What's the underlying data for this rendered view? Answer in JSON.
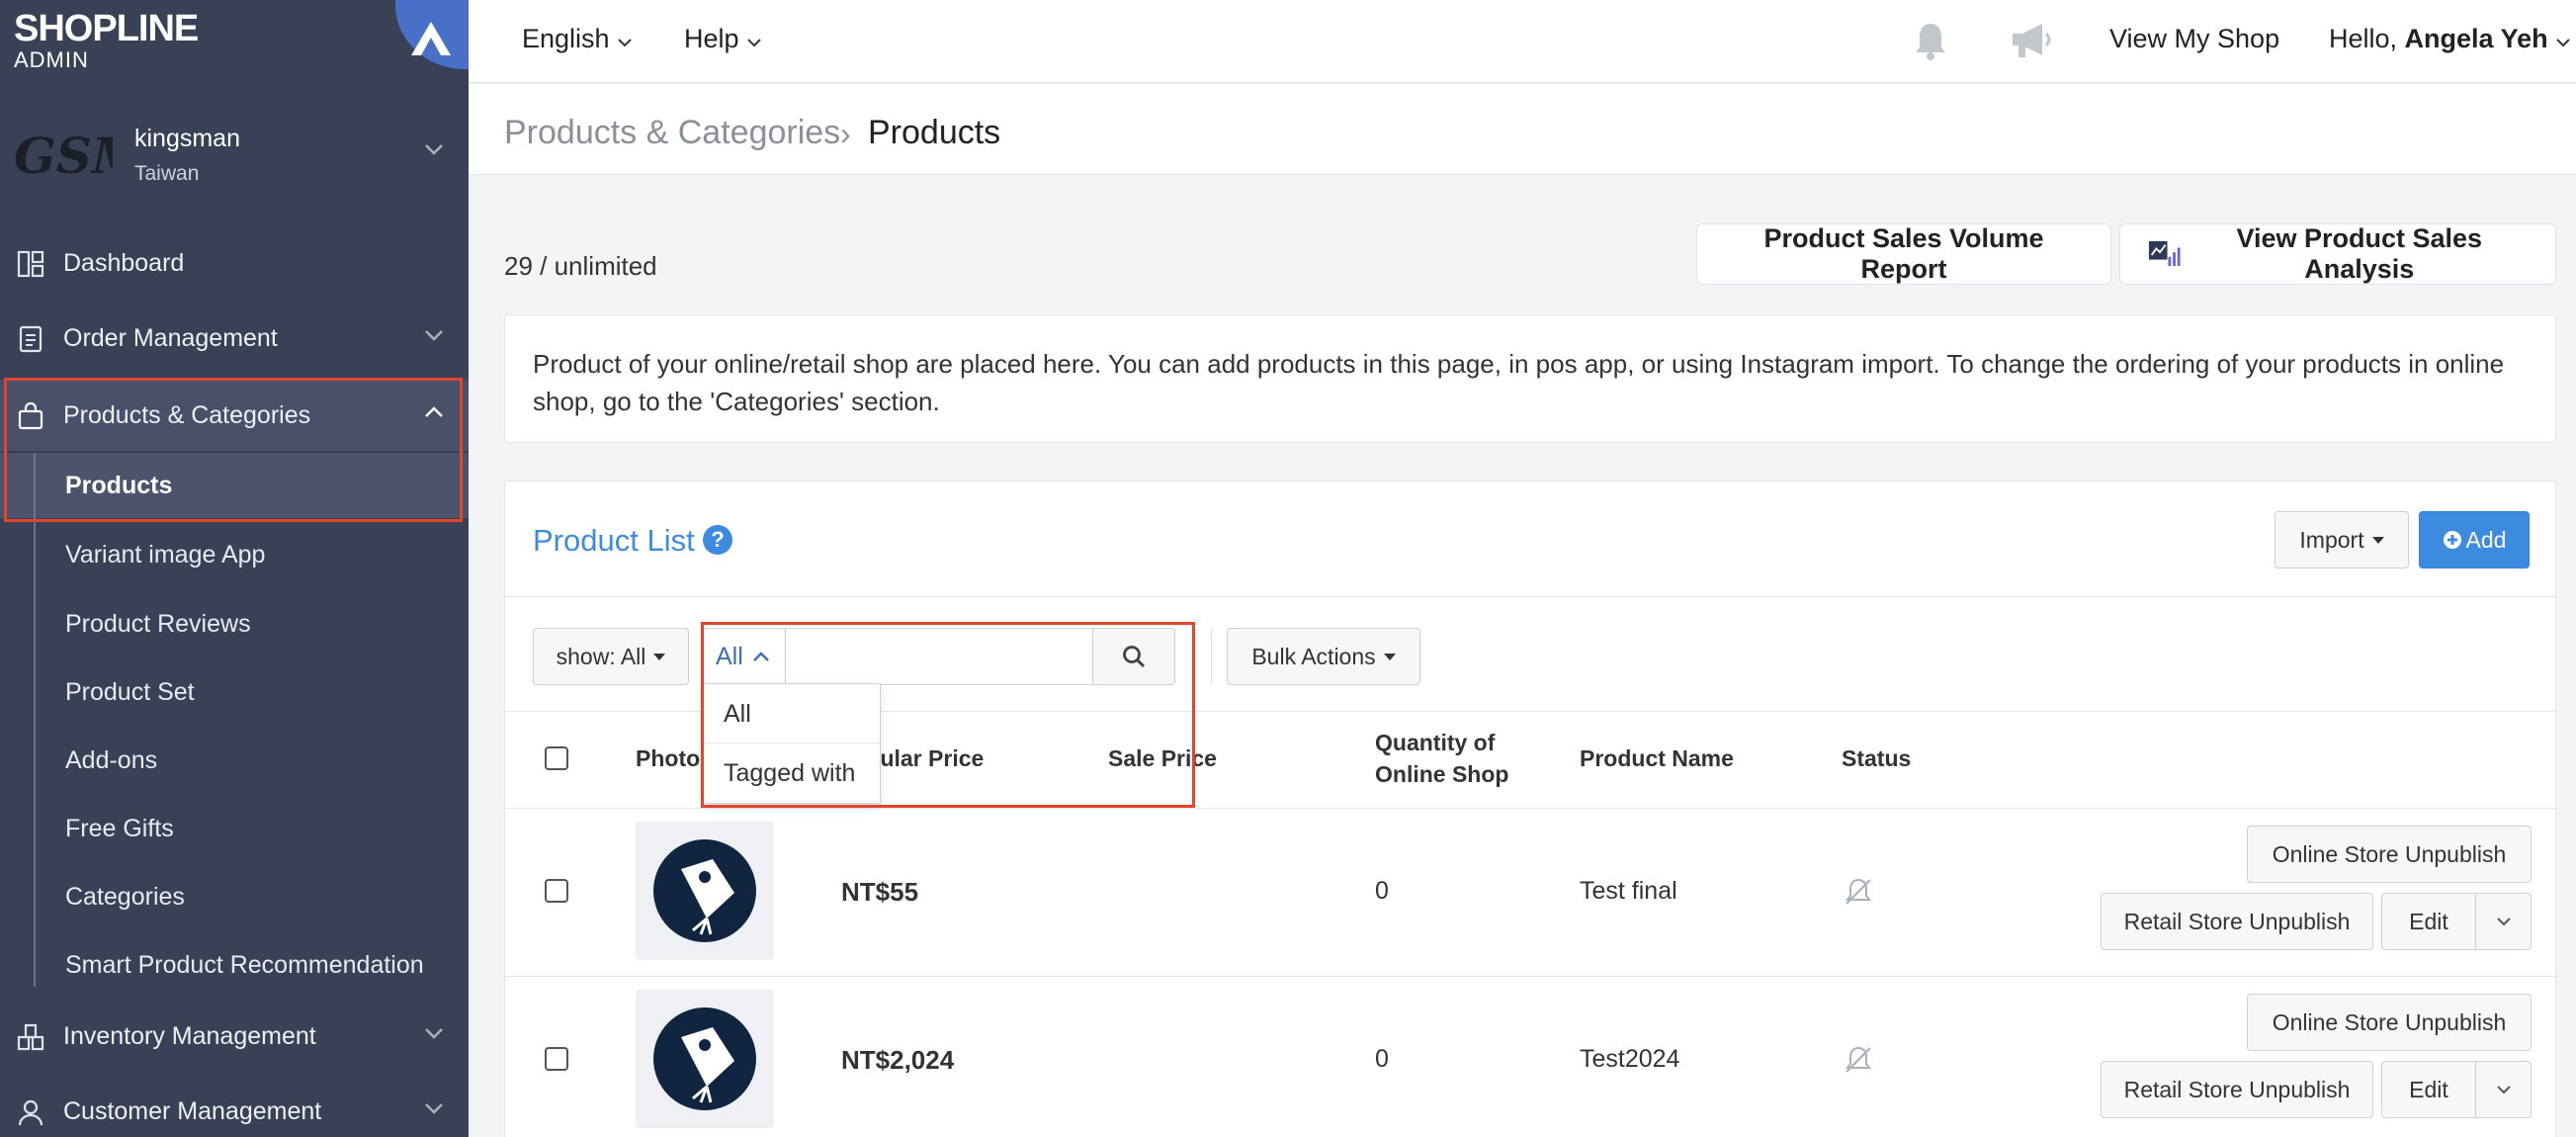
{
  "brand": {
    "logo": "SHOPLINE",
    "subtitle": "ADMIN"
  },
  "shop": {
    "logo_text": "GSM",
    "name": "kingsman",
    "region": "Taiwan"
  },
  "nav": {
    "dashboard": "Dashboard",
    "orders": "Order Management",
    "products": "Products & Categories",
    "inventory": "Inventory Management",
    "customers": "Customer Management"
  },
  "subnav": {
    "products": "Products",
    "variant_image": "Variant image App",
    "reviews": "Product Reviews",
    "product_set": "Product Set",
    "addons": "Add-ons",
    "free_gifts": "Free Gifts",
    "categories": "Categories",
    "recommendation": "Smart Product Recommendation"
  },
  "topbar": {
    "language": "English",
    "help": "Help",
    "view_shop": "View My Shop",
    "greeting": "Hello, ",
    "user": "Angela Yeh"
  },
  "breadcrumb": {
    "parent": "Products & Categories",
    "separator": "›",
    "current": "Products"
  },
  "count": "29 / unlimited",
  "buttons": {
    "sales_volume": "Product Sales Volume Report",
    "sales_analysis": "View Product Sales Analysis",
    "import": "Import",
    "add": "Add",
    "show": "show: All",
    "bulk": "Bulk Actions"
  },
  "info": "Product of your online/retail shop are placed here. You can add products in this page, in pos app, or using Instagram import. To change the ordering of your products in online shop, go to the 'Categories' section.",
  "list": {
    "title": "Product List",
    "help_glyph": "?",
    "search_scope": "All",
    "search_value": "",
    "dropdown": [
      "All",
      "Tagged with"
    ],
    "headers": {
      "photo": "Photo",
      "regular_price": "Regular Price",
      "sale_price": "Sale Price",
      "quantity_line1": "Quantity of",
      "quantity_line2": "Online Shop",
      "name": "Product Name",
      "status": "Status"
    },
    "rows": [
      {
        "price": "NT$55",
        "quantity": "0",
        "name": "Test final",
        "online_btn": "Online Store Unpublish",
        "retail_btn": "Retail Store Unpublish",
        "edit": "Edit"
      },
      {
        "price": "NT$2,024",
        "quantity": "0",
        "name": "Test2024",
        "online_btn": "Online Store Unpublish",
        "retail_btn": "Retail Store Unpublish",
        "edit": "Edit"
      }
    ]
  },
  "colors": {
    "sidebar": "#384156",
    "accent": "#3d8be0",
    "highlight": "#e2442c",
    "link": "#3d8be0"
  }
}
